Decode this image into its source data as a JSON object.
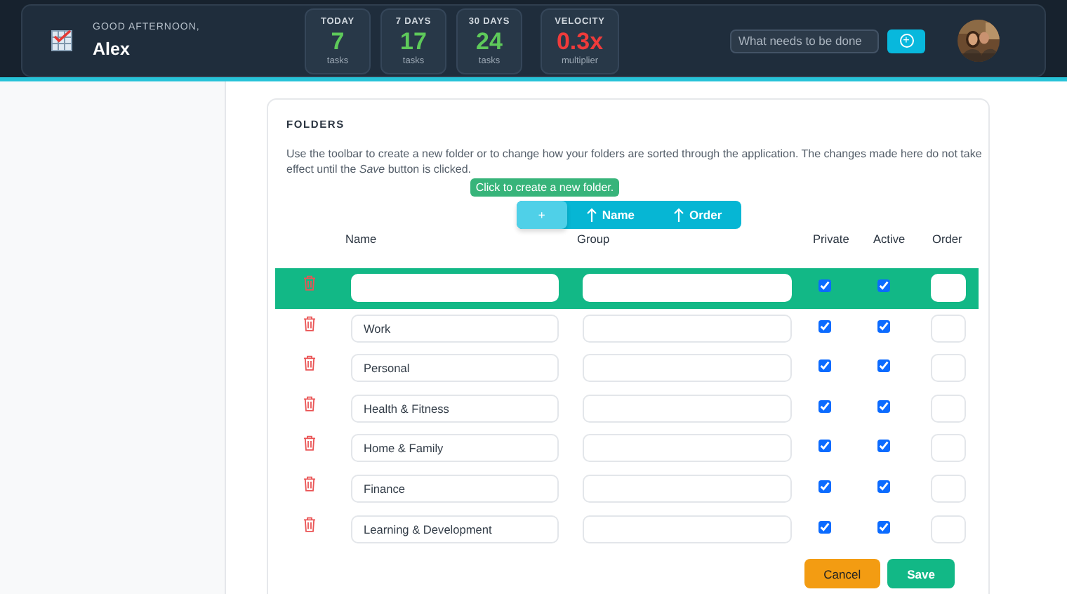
{
  "header": {
    "greeting": "GOOD AFTERNOON,",
    "user_name": "Alex",
    "stats": [
      {
        "label": "TODAY",
        "value": "7",
        "unit": "tasks",
        "color": "#5ec95a"
      },
      {
        "label": "7 DAYS",
        "value": "17",
        "unit": "tasks",
        "color": "#5ec95a"
      },
      {
        "label": "30 DAYS",
        "value": "24",
        "unit": "tasks",
        "color": "#5ec95a"
      },
      {
        "label": "VELOCITY",
        "value": "0.3x",
        "unit": "multiplier",
        "color": "#ef3b3b"
      }
    ],
    "search": {
      "placeholder": "What needs to be done"
    },
    "add_button": {
      "label": "+"
    }
  },
  "folders": {
    "title": "FOLDERS",
    "description": "Use the toolbar to create a new folder or to change how your folders are sorted through the application. The changes made here do not take effect until the *Save* button is clicked.",
    "tooltip": "Click to create a new folder.",
    "toolbar": [
      {
        "kind": "add",
        "label": "+"
      },
      {
        "kind": "sort",
        "label": "Name"
      },
      {
        "kind": "sort",
        "label": "Order"
      }
    ],
    "columns": [
      "Name",
      "Group",
      "Private",
      "Active",
      "Order"
    ],
    "rows": [
      {
        "kind": "new",
        "private": true,
        "active": true
      },
      {
        "kind": "existing",
        "name": "Work",
        "private": true,
        "active": true
      },
      {
        "kind": "existing",
        "name": "Personal",
        "private": true,
        "active": true
      },
      {
        "kind": "existing",
        "name": "Health & Fitness",
        "private": true,
        "active": true
      },
      {
        "kind": "existing",
        "name": "Home & Family",
        "private": true,
        "active": true
      },
      {
        "kind": "existing",
        "name": "Finance",
        "private": true,
        "active": true
      },
      {
        "kind": "existing",
        "name": "Learning & Development",
        "private": true,
        "active": true
      }
    ],
    "buttons": [
      {
        "kind": "cancel",
        "label": "Cancel"
      },
      {
        "kind": "save",
        "label": "Save"
      }
    ]
  }
}
